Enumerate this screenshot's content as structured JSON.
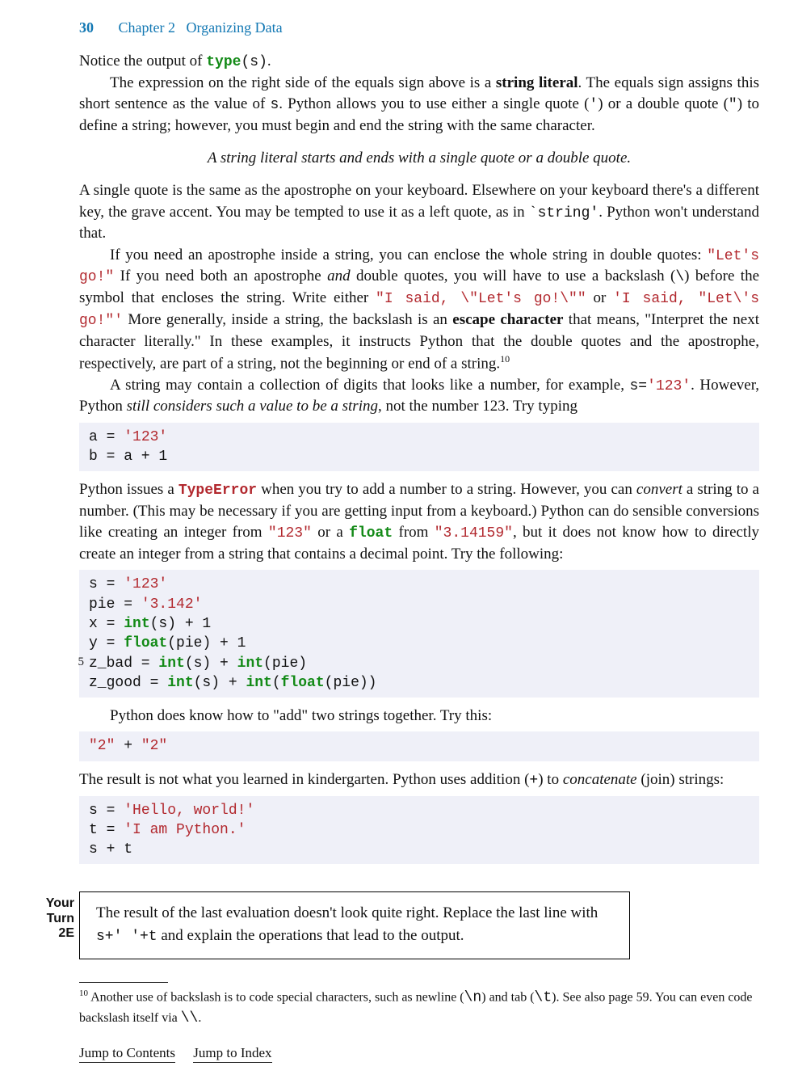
{
  "header": {
    "pageno": "30",
    "chapter": "Chapter 2",
    "title": "Organizing Data"
  },
  "p1_a": "Notice the output of ",
  "p1_code": "type(s)",
  "p1_type": "type",
  "p1_sfx": "(s)",
  "p1_b": ".",
  "p2": "The expression on the right side of the equals sign above is a ",
  "p2_b1": "string literal",
  "p2_c": ". The equals sign assigns this short sentence as the value of ",
  "p2_s": "s",
  "p2_d": ". Python allows you to use either a single quote (",
  "p2_q1": "'",
  "p2_e": ") or a double quote (",
  "p2_q2": "\"",
  "p2_f": ") to define a string; however, you must begin and end the string with the same character.",
  "axiom": "A string literal starts and ends with a single quote or a double quote.",
  "p3_a": "A single quote is the same as the apostrophe on your keyboard. Elsewhere on your keyboard there's a different key, the grave accent. You may be tempted to use it as a left quote, as in ",
  "p3_code": "`string'",
  "p3_b": ". Python won't understand that.",
  "p4_a": "If you need an apostrophe inside a string, you can enclose the whole string in double quotes: ",
  "p4_code1": "\"Let's go!\"",
  "p4_b": " If you need both an apostrophe ",
  "p4_and": "and",
  "p4_c": " double quotes, you will have to use a back­slash (",
  "p4_bs": "\\",
  "p4_d": ") before the symbol that encloses the string. Write either ",
  "p4_code2": "\"I said, \\\"Let's go!\\\"\"",
  "p4_e": " or ",
  "p4_code3": "'I said, \"Let\\'s go!\"'",
  "p4_f": " More generally, inside a string, the backslash is an ",
  "p4_esc": "escape character",
  "p4_g": " that means, \"Interpret the next character literally.\" In these examples, it instructs Python that the double quotes and the apostrophe, respectively, are part of a string, not the beginning or end of a string.",
  "p4_fn": "10",
  "p5_a": "A string may contain a collection of digits that looks like a number, for example, ",
  "p5_s": "s=",
  "p5_code": "'123'",
  "p5_b": ". However, Python ",
  "p5_it": "still considers such a value to be a string",
  "p5_c": ", not the number 123. Try typing",
  "cb1_l1_a": "a = ",
  "cb1_l1_b": "'123'",
  "cb1_l2": "b = a + 1",
  "p6_a": "Python issues a ",
  "p6_err": "TypeError",
  "p6_b": " when you try to add a number to a string. However, you can ",
  "p6_cv": "convert",
  "p6_c": " a string to a number. (This may be necessary if you are getting input from a keyboard.) Python can do sensible conversions like creating an integer from ",
  "p6_code1": "\"123\"",
  "p6_d": " or a ",
  "p6_float": "float",
  "p6_e": " from ",
  "p6_code2": "\"3.14159\"",
  "p6_f": ", but it does not know how to directly create an integer from a string that contains a decimal point. Try the following:",
  "cb2": {
    "l1a": "s = ",
    "l1b": "'123'",
    "l2a": "pie = ",
    "l2b": "'3.142'",
    "l3a": "x = ",
    "l3b": "int",
    "l3c": "(s) + 1",
    "l4a": "y = ",
    "l4b": "float",
    "l4c": "(pie) + 1",
    "l5a": "z_bad = ",
    "l5b": "int",
    "l5c": "(s) + ",
    "l5d": "int",
    "l5e": "(pie)",
    "l6a": "z_good = ",
    "l6b": "int",
    "l6c": "(s) + ",
    "l6d": "int",
    "l6e": "(",
    "l6f": "float",
    "l6g": "(pie))",
    "lineno": "5"
  },
  "p7": "Python does know how to \"add\" two strings together. Try this:",
  "cb3_a": "\"2\"",
  "cb3_b": " + ",
  "cb3_c": "\"2\"",
  "p8_a": "The result is not what you learned in kindergarten. Python uses addition (",
  "p8_plus": "+",
  "p8_b": ") to ",
  "p8_cat": "concatenate",
  "p8_c": " (join) strings:",
  "cb4": {
    "l1a": "s = ",
    "l1b": "'Hello, world!'",
    "l2a": "t = ",
    "l2b": "'I am Python.'",
    "l3": "s + t"
  },
  "yt": {
    "label_l1": "Your",
    "label_l2": "Turn",
    "label_l3": "2E",
    "text_a": "The result of the last evaluation doesn't look quite right. Replace the last line with ",
    "code": "s+'  '+t",
    "text_b": " and explain the operations that lead to the output."
  },
  "footnote": {
    "num": "10",
    "a": " Another use of backslash is to code special characters, such as newline (",
    "c1": "\\n",
    "b": ") and tab (",
    "c2": "\\t",
    "c": "). See also page 59. You can even code backslash itself via ",
    "c3": "\\\\",
    "d": "."
  },
  "links": {
    "contents": "Jump to Contents",
    "index": "Jump to Index"
  }
}
